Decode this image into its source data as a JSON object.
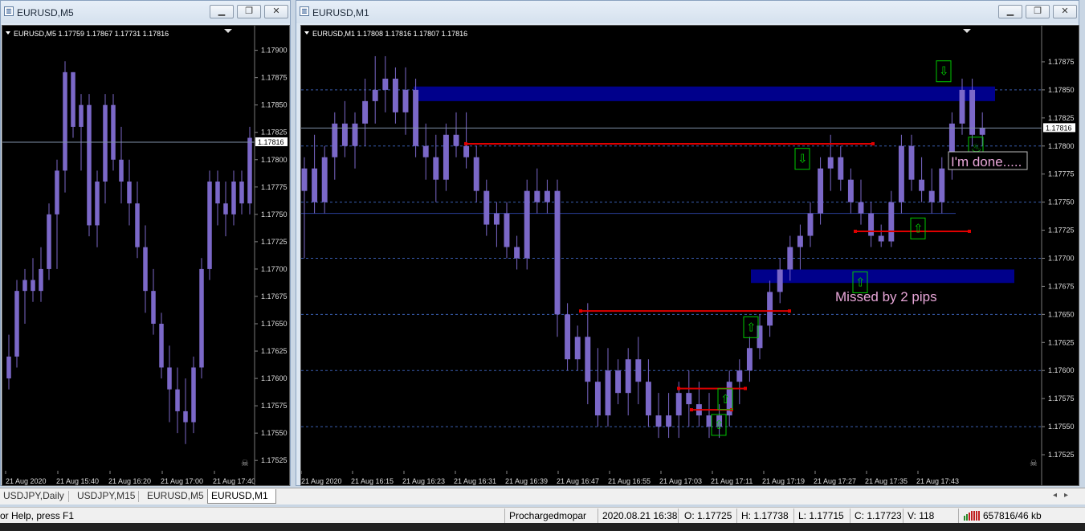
{
  "windows": {
    "left": {
      "title": "EURUSD,M5",
      "header": "EURUSD,M5  1.17759 1.17867 1.17731 1.17816",
      "current_price": "1.17816"
    },
    "right": {
      "title": "EURUSD,M1",
      "header": "EURUSD,M1  1.17808 1.17816 1.17807 1.17816",
      "current_price": "1.17816"
    }
  },
  "window_buttons": {
    "minimize": "▁",
    "restore": "❐",
    "close": "✕"
  },
  "chart_data": [
    {
      "type": "candlestick",
      "title": "EURUSD,M5",
      "ohlc_header": {
        "open": 1.17759,
        "high": 1.17867,
        "low": 1.17731,
        "close": 1.17816
      },
      "ylim": [
        1.1752,
        1.1791
      ],
      "yticks": [
        "1.17900",
        "1.17875",
        "1.17850",
        "1.17825",
        "1.17800",
        "1.17775",
        "1.17750",
        "1.17725",
        "1.17700",
        "1.17675",
        "1.17650",
        "1.17625",
        "1.17600",
        "1.17575",
        "1.17550",
        "1.17525"
      ],
      "xticks": [
        "21 Aug 2020",
        "21 Aug 15:40",
        "21 Aug 16:20",
        "21 Aug 17:00",
        "21 Aug 17:40"
      ],
      "current_price": 1.17816,
      "bull_color": "#7b68c8",
      "candles": [
        {
          "o": 1.176,
          "h": 1.1764,
          "l": 1.1759,
          "c": 1.1762
        },
        {
          "o": 1.1762,
          "h": 1.1769,
          "l": 1.1761,
          "c": 1.1768
        },
        {
          "o": 1.1768,
          "h": 1.177,
          "l": 1.1765,
          "c": 1.1769
        },
        {
          "o": 1.1769,
          "h": 1.1771,
          "l": 1.1767,
          "c": 1.1768
        },
        {
          "o": 1.1768,
          "h": 1.1772,
          "l": 1.1767,
          "c": 1.177
        },
        {
          "o": 1.177,
          "h": 1.1776,
          "l": 1.1769,
          "c": 1.1775
        },
        {
          "o": 1.1775,
          "h": 1.178,
          "l": 1.177,
          "c": 1.1779
        },
        {
          "o": 1.1779,
          "h": 1.1789,
          "l": 1.1777,
          "c": 1.1788
        },
        {
          "o": 1.1788,
          "h": 1.1788,
          "l": 1.1782,
          "c": 1.1783
        },
        {
          "o": 1.1783,
          "h": 1.1786,
          "l": 1.1779,
          "c": 1.1785
        },
        {
          "o": 1.1785,
          "h": 1.1786,
          "l": 1.1773,
          "c": 1.1774
        },
        {
          "o": 1.1774,
          "h": 1.1779,
          "l": 1.1772,
          "c": 1.1778
        },
        {
          "o": 1.1778,
          "h": 1.1786,
          "l": 1.1776,
          "c": 1.1785
        },
        {
          "o": 1.1785,
          "h": 1.1786,
          "l": 1.1779,
          "c": 1.178
        },
        {
          "o": 1.178,
          "h": 1.1783,
          "l": 1.1776,
          "c": 1.1778
        },
        {
          "o": 1.1778,
          "h": 1.178,
          "l": 1.1774,
          "c": 1.1776
        },
        {
          "o": 1.1776,
          "h": 1.1778,
          "l": 1.1771,
          "c": 1.1772
        },
        {
          "o": 1.1772,
          "h": 1.1774,
          "l": 1.1766,
          "c": 1.1768
        },
        {
          "o": 1.1768,
          "h": 1.177,
          "l": 1.1764,
          "c": 1.1765
        },
        {
          "o": 1.1765,
          "h": 1.1766,
          "l": 1.176,
          "c": 1.1761
        },
        {
          "o": 1.1761,
          "h": 1.1763,
          "l": 1.1756,
          "c": 1.1759
        },
        {
          "o": 1.1759,
          "h": 1.1761,
          "l": 1.1755,
          "c": 1.1757
        },
        {
          "o": 1.1757,
          "h": 1.176,
          "l": 1.1754,
          "c": 1.1756
        },
        {
          "o": 1.1756,
          "h": 1.1762,
          "l": 1.1755,
          "c": 1.1761
        },
        {
          "o": 1.1761,
          "h": 1.1771,
          "l": 1.176,
          "c": 1.177
        },
        {
          "o": 1.177,
          "h": 1.1779,
          "l": 1.1769,
          "c": 1.1778
        },
        {
          "o": 1.1778,
          "h": 1.1779,
          "l": 1.1774,
          "c": 1.1776
        },
        {
          "o": 1.1776,
          "h": 1.1778,
          "l": 1.1773,
          "c": 1.1775
        },
        {
          "o": 1.1775,
          "h": 1.1779,
          "l": 1.1774,
          "c": 1.1778
        },
        {
          "o": 1.1778,
          "h": 1.1779,
          "l": 1.1775,
          "c": 1.1776
        },
        {
          "o": 1.1776,
          "h": 1.1783,
          "l": 1.1775,
          "c": 1.1782
        }
      ]
    },
    {
      "type": "candlestick",
      "title": "EURUSD,M1",
      "ohlc_header": {
        "open": 1.17808,
        "high": 1.17816,
        "low": 1.17807,
        "close": 1.17816
      },
      "ylim": [
        1.17515,
        1.17895
      ],
      "yticks": [
        "1.17875",
        "1.17850",
        "1.17825",
        "1.17800",
        "1.17775",
        "1.17750",
        "1.17725",
        "1.17700",
        "1.17675",
        "1.17650",
        "1.17625",
        "1.17600",
        "1.17575",
        "1.17550",
        "1.17525"
      ],
      "xticks": [
        "21 Aug 2020",
        "21 Aug 16:15",
        "21 Aug 16:23",
        "21 Aug 16:31",
        "21 Aug 16:39",
        "21 Aug 16:47",
        "21 Aug 16:55",
        "21 Aug 17:03",
        "21 Aug 17:11",
        "21 Aug 17:19",
        "21 Aug 17:27",
        "21 Aug 17:35",
        "21 Aug 17:43"
      ],
      "current_price": 1.17816,
      "bull_color": "#7b68c8",
      "grid_levels": [
        1.1785,
        1.178,
        1.1775,
        1.177,
        1.1765,
        1.176,
        1.1755
      ],
      "support_line": 1.1774,
      "zones": [
        {
          "from": 1.17853,
          "to": 1.1784
        },
        {
          "from": 1.1769,
          "to": 1.17678
        }
      ],
      "red_lines": [
        1.17802,
        1.17653,
        1.17584,
        1.17565,
        1.17724
      ],
      "annotations": [
        "I'm done.....",
        "Missed by 2 pips"
      ],
      "candles": [
        {
          "o": 1.1776,
          "h": 1.1779,
          "l": 1.177,
          "c": 1.1778
        },
        {
          "o": 1.1778,
          "h": 1.1781,
          "l": 1.1774,
          "c": 1.1775
        },
        {
          "o": 1.1775,
          "h": 1.178,
          "l": 1.1774,
          "c": 1.1779
        },
        {
          "o": 1.1779,
          "h": 1.1783,
          "l": 1.1777,
          "c": 1.1782
        },
        {
          "o": 1.1782,
          "h": 1.1784,
          "l": 1.1779,
          "c": 1.178
        },
        {
          "o": 1.178,
          "h": 1.1783,
          "l": 1.1778,
          "c": 1.1782
        },
        {
          "o": 1.1782,
          "h": 1.1786,
          "l": 1.178,
          "c": 1.1784
        },
        {
          "o": 1.1784,
          "h": 1.1788,
          "l": 1.1782,
          "c": 1.1785
        },
        {
          "o": 1.1785,
          "h": 1.1788,
          "l": 1.1783,
          "c": 1.1786
        },
        {
          "o": 1.1786,
          "h": 1.1787,
          "l": 1.1782,
          "c": 1.1783
        },
        {
          "o": 1.1783,
          "h": 1.1787,
          "l": 1.1781,
          "c": 1.1785
        },
        {
          "o": 1.1785,
          "h": 1.1786,
          "l": 1.1779,
          "c": 1.178
        },
        {
          "o": 1.178,
          "h": 1.1782,
          "l": 1.1777,
          "c": 1.1779
        },
        {
          "o": 1.1779,
          "h": 1.1781,
          "l": 1.1775,
          "c": 1.1777
        },
        {
          "o": 1.1777,
          "h": 1.1782,
          "l": 1.1776,
          "c": 1.1781
        },
        {
          "o": 1.1781,
          "h": 1.1783,
          "l": 1.1779,
          "c": 1.178
        },
        {
          "o": 1.178,
          "h": 1.1783,
          "l": 1.1778,
          "c": 1.1779
        },
        {
          "o": 1.1779,
          "h": 1.178,
          "l": 1.1775,
          "c": 1.1776
        },
        {
          "o": 1.1776,
          "h": 1.1777,
          "l": 1.1772,
          "c": 1.1773
        },
        {
          "o": 1.1773,
          "h": 1.1775,
          "l": 1.1771,
          "c": 1.1774
        },
        {
          "o": 1.1774,
          "h": 1.1775,
          "l": 1.177,
          "c": 1.1771
        },
        {
          "o": 1.1771,
          "h": 1.1772,
          "l": 1.1769,
          "c": 1.177
        },
        {
          "o": 1.177,
          "h": 1.1777,
          "l": 1.1769,
          "c": 1.1776
        },
        {
          "o": 1.1776,
          "h": 1.1778,
          "l": 1.1774,
          "c": 1.1775
        },
        {
          "o": 1.1775,
          "h": 1.1777,
          "l": 1.1774,
          "c": 1.1776
        },
        {
          "o": 1.1776,
          "h": 1.1777,
          "l": 1.1763,
          "c": 1.1765
        },
        {
          "o": 1.1765,
          "h": 1.1766,
          "l": 1.176,
          "c": 1.1761
        },
        {
          "o": 1.1761,
          "h": 1.1764,
          "l": 1.176,
          "c": 1.1763
        },
        {
          "o": 1.1763,
          "h": 1.1766,
          "l": 1.1757,
          "c": 1.1759
        },
        {
          "o": 1.1759,
          "h": 1.1762,
          "l": 1.1755,
          "c": 1.1756
        },
        {
          "o": 1.1756,
          "h": 1.1762,
          "l": 1.1755,
          "c": 1.176
        },
        {
          "o": 1.176,
          "h": 1.1761,
          "l": 1.1757,
          "c": 1.1758
        },
        {
          "o": 1.1758,
          "h": 1.1762,
          "l": 1.1756,
          "c": 1.1761
        },
        {
          "o": 1.1761,
          "h": 1.1763,
          "l": 1.1757,
          "c": 1.1759
        },
        {
          "o": 1.1759,
          "h": 1.1761,
          "l": 1.1755,
          "c": 1.1756
        },
        {
          "o": 1.1756,
          "h": 1.1758,
          "l": 1.1754,
          "c": 1.1755
        },
        {
          "o": 1.1755,
          "h": 1.1758,
          "l": 1.1754,
          "c": 1.1756
        },
        {
          "o": 1.1756,
          "h": 1.1759,
          "l": 1.1754,
          "c": 1.1758
        },
        {
          "o": 1.1758,
          "h": 1.176,
          "l": 1.1755,
          "c": 1.1757
        },
        {
          "o": 1.1757,
          "h": 1.1759,
          "l": 1.1755,
          "c": 1.1756
        },
        {
          "o": 1.1756,
          "h": 1.1758,
          "l": 1.1754,
          "c": 1.1755
        },
        {
          "o": 1.1755,
          "h": 1.1757,
          "l": 1.1754,
          "c": 1.1756
        },
        {
          "o": 1.1756,
          "h": 1.176,
          "l": 1.1755,
          "c": 1.1759
        },
        {
          "o": 1.1759,
          "h": 1.1761,
          "l": 1.1757,
          "c": 1.176
        },
        {
          "o": 1.176,
          "h": 1.1763,
          "l": 1.1759,
          "c": 1.1762
        },
        {
          "o": 1.1762,
          "h": 1.1765,
          "l": 1.1761,
          "c": 1.1764
        },
        {
          "o": 1.1764,
          "h": 1.1768,
          "l": 1.1763,
          "c": 1.1767
        },
        {
          "o": 1.1767,
          "h": 1.177,
          "l": 1.1766,
          "c": 1.1769
        },
        {
          "o": 1.1769,
          "h": 1.1772,
          "l": 1.1768,
          "c": 1.1771
        },
        {
          "o": 1.1771,
          "h": 1.1773,
          "l": 1.1769,
          "c": 1.1772
        },
        {
          "o": 1.1772,
          "h": 1.1775,
          "l": 1.1771,
          "c": 1.1774
        },
        {
          "o": 1.1774,
          "h": 1.1779,
          "l": 1.1773,
          "c": 1.1778
        },
        {
          "o": 1.1778,
          "h": 1.1781,
          "l": 1.1776,
          "c": 1.1779
        },
        {
          "o": 1.1779,
          "h": 1.178,
          "l": 1.1776,
          "c": 1.1777
        },
        {
          "o": 1.1777,
          "h": 1.1778,
          "l": 1.1774,
          "c": 1.1775
        },
        {
          "o": 1.1775,
          "h": 1.1777,
          "l": 1.1773,
          "c": 1.1774
        },
        {
          "o": 1.1774,
          "h": 1.1775,
          "l": 1.1771,
          "c": 1.1772
        },
        {
          "o": 1.1772,
          "h": 1.1773,
          "l": 1.1771,
          "c": 1.17715
        },
        {
          "o": 1.17715,
          "h": 1.1776,
          "l": 1.1771,
          "c": 1.1775
        },
        {
          "o": 1.1775,
          "h": 1.1781,
          "l": 1.1774,
          "c": 1.178
        },
        {
          "o": 1.178,
          "h": 1.1781,
          "l": 1.1776,
          "c": 1.1777
        },
        {
          "o": 1.1777,
          "h": 1.1779,
          "l": 1.1775,
          "c": 1.1776
        },
        {
          "o": 1.1776,
          "h": 1.1778,
          "l": 1.1774,
          "c": 1.1775
        },
        {
          "o": 1.1775,
          "h": 1.1779,
          "l": 1.1774,
          "c": 1.1778
        },
        {
          "o": 1.1778,
          "h": 1.1783,
          "l": 1.1777,
          "c": 1.1782
        },
        {
          "o": 1.1782,
          "h": 1.1786,
          "l": 1.1781,
          "c": 1.1785
        },
        {
          "o": 1.1785,
          "h": 1.1786,
          "l": 1.178,
          "c": 1.1781
        },
        {
          "o": 1.1781,
          "h": 1.1783,
          "l": 1.178,
          "c": 1.17816
        }
      ]
    }
  ],
  "annotations": {
    "done": "I'm done.....",
    "missed": "Missed by 2 pips"
  },
  "tabs": [
    {
      "label": "USDJPY,Daily",
      "active": false
    },
    {
      "label": "USDJPY,M15",
      "active": false
    },
    {
      "label": "EURUSD,M5",
      "active": false
    },
    {
      "label": "EURUSD,M1",
      "active": true
    }
  ],
  "statusbar": {
    "help": "or Help, press F1",
    "profile": "Prochargedmopar",
    "datetime": "2020.08.21 16:38",
    "open": "O: 1.17725",
    "high": "H: 1.17738",
    "low": "L: 1.17715",
    "close": "C: 1.17723",
    "volume": "V: 118",
    "traffic": "657816/46 kb"
  },
  "colors": {
    "candle": "#7b68c8",
    "zone": "#00008b",
    "red_line": "#e00000",
    "grid": "#3a5db0",
    "annotation_pink": "#e8a6d8",
    "arrow_green": "#00c800"
  }
}
